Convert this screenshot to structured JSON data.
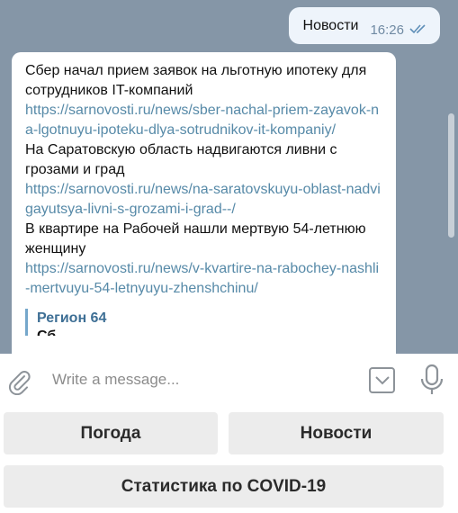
{
  "outgoing": {
    "text": "Новости",
    "time": "16:26"
  },
  "incoming": {
    "items": [
      {
        "title": "Сбер начал прием заявок на льготную ипотеку для сотрудников IT-компаний",
        "url": "https://sarnovosti.ru/news/sber-nachal-priem-zayavok-na-lgotnuyu-ipoteku-dlya-sotrudnikov-it-kompaniy/"
      },
      {
        "title": "На Саратовскую область надвигаются ливни с грозами и град",
        "url": "https://sarnovosti.ru/news/na-saratovskuyu-oblast-nadvigayutsya-livni-s-grozami-i-grad--/"
      },
      {
        "title": "В квартире на Рабочей нашли мертвую 54-летнюю женщину",
        "url": "https://sarnovosti.ru/news/v-kvartire-na-rabochey-nashli-mertvuyu-54-letnyuyu-zhenshchinu/"
      }
    ],
    "preview": {
      "site": "Регион 64",
      "cut_text": "Сб"
    }
  },
  "input": {
    "placeholder": "Write a message..."
  },
  "keyboard": {
    "weather": "Погода",
    "news": "Новости",
    "covid": "Статистика по COVID-19"
  }
}
